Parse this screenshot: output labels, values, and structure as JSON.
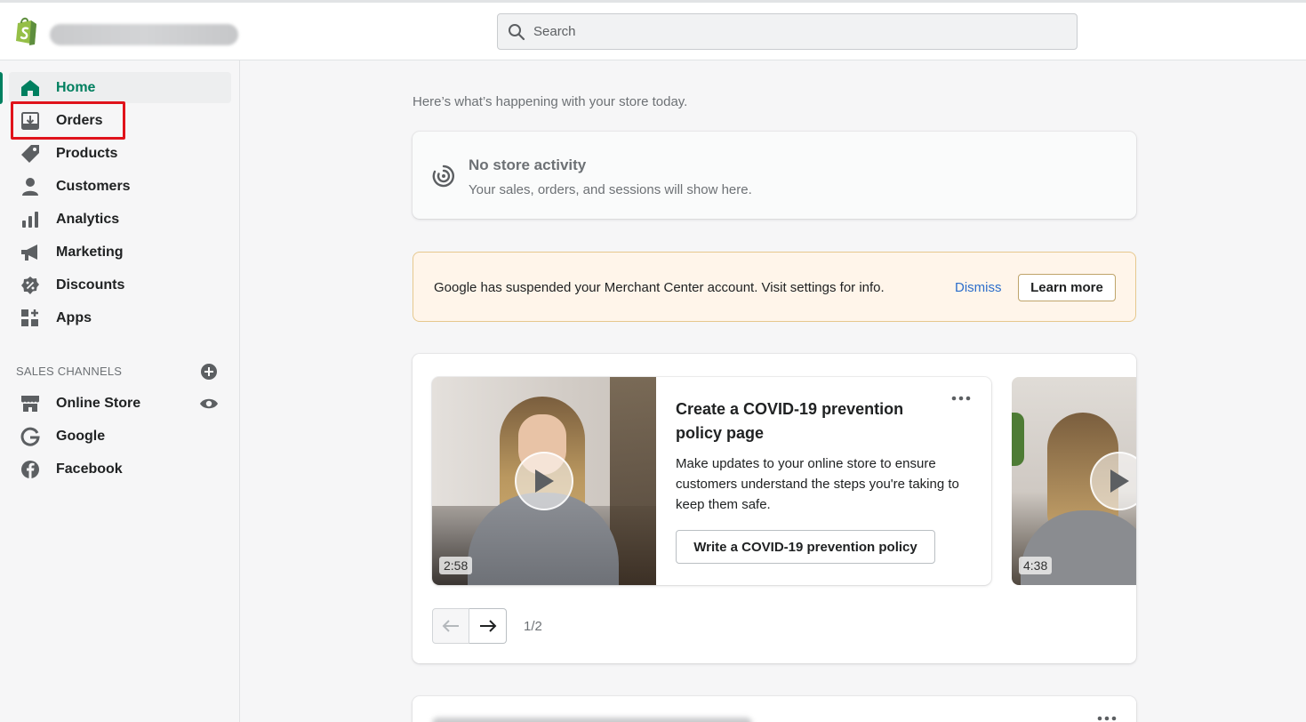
{
  "header": {
    "search": {
      "placeholder": "Search"
    }
  },
  "sidebar": {
    "items": [
      {
        "label": "Home",
        "icon": "home-icon",
        "active": true
      },
      {
        "label": "Orders",
        "icon": "orders-icon",
        "highlighted": true
      },
      {
        "label": "Products",
        "icon": "tag-icon"
      },
      {
        "label": "Customers",
        "icon": "person-icon"
      },
      {
        "label": "Analytics",
        "icon": "bar-chart-icon"
      },
      {
        "label": "Marketing",
        "icon": "megaphone-icon"
      },
      {
        "label": "Discounts",
        "icon": "discount-badge-icon"
      },
      {
        "label": "Apps",
        "icon": "apps-grid-icon"
      }
    ],
    "sales_channels": {
      "title": "SALES CHANNELS",
      "items": [
        {
          "label": "Online Store",
          "icon": "storefront-icon"
        },
        {
          "label": "Google",
          "icon": "google-icon"
        },
        {
          "label": "Facebook",
          "icon": "facebook-icon"
        }
      ]
    }
  },
  "main": {
    "greeting": "Here’s what’s happening with your store today.",
    "activity": {
      "title": "No store activity",
      "subtitle": "Your sales, orders, and sessions will show here."
    },
    "banner": {
      "text": "Google has suspended your Merchant Center account. Visit settings for info.",
      "dismiss_label": "Dismiss",
      "learn_more_label": "Learn more"
    },
    "carousel": {
      "slides": [
        {
          "title": "Create a COVID-19 prevention policy page",
          "description": "Make updates to your online store to ensure customers understand the steps you're taking to keep them safe.",
          "button_label": "Write a COVID-19 prevention policy",
          "duration": "2:58"
        },
        {
          "duration": "4:38"
        }
      ],
      "page_indicator": "1/2"
    }
  },
  "colors": {
    "brand_green": "#008060",
    "active_text": "#007f5f",
    "highlight_red": "#e0131b",
    "link_blue": "#2c6ecb",
    "banner_bg": "#fff5ea"
  }
}
